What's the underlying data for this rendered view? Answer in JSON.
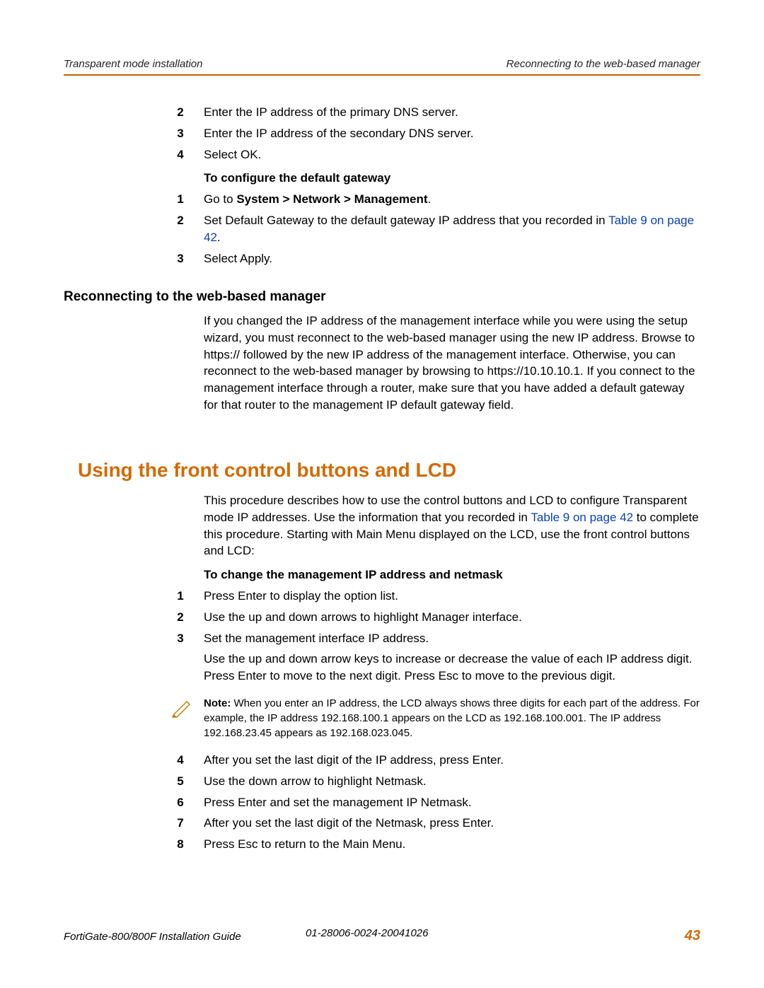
{
  "header": {
    "left": "Transparent mode installation",
    "right": "Reconnecting to the web-based manager"
  },
  "steps_a": {
    "s2": {
      "n": "2",
      "t": "Enter the IP address of the primary DNS server."
    },
    "s3": {
      "n": "3",
      "t": "Enter the IP address of the secondary DNS server."
    },
    "s4": {
      "n": "4",
      "t": "Select OK."
    }
  },
  "gateway": {
    "heading": "To configure the default gateway",
    "s1": {
      "n": "1",
      "pre": "Go to ",
      "bold": "System > Network > Management",
      "post": "."
    },
    "s2": {
      "n": "2",
      "pre": "Set Default Gateway to the default gateway IP address that you recorded in ",
      "link": "Table 9 on page 42",
      "post": "."
    },
    "s3": {
      "n": "3",
      "t": "Select Apply."
    }
  },
  "reconnect": {
    "heading": "Reconnecting to the web-based manager",
    "para": "If you changed the IP address of the management interface while you were using the setup wizard, you must reconnect to the web-based manager using the new IP address. Browse to https:// followed by the new IP address of the management interface. Otherwise, you can reconnect to the web-based manager by browsing to https://10.10.10.1. If you connect to the management interface through a router, make sure that you have added a default gateway for that router to the management IP default gateway field."
  },
  "lcd": {
    "heading": "Using the front control buttons and LCD",
    "intro_pre": "This procedure describes how to use the control buttons and LCD to configure Transparent mode IP addresses. Use the information that you recorded in ",
    "intro_link": "Table 9 on page 42",
    "intro_post": " to complete this procedure. Starting with Main Menu displayed on the LCD, use the front control buttons and LCD:",
    "sub": "To change the management IP address and netmask",
    "s1": {
      "n": "1",
      "t": "Press Enter to display the option list."
    },
    "s2": {
      "n": "2",
      "t": "Use the up and down arrows to highlight Manager interface."
    },
    "s3": {
      "n": "3",
      "t": "Set the management interface IP address.",
      "extra": "Use the up and down arrow keys to increase or decrease the value of each IP address digit. Press Enter to move to the next digit. Press Esc to move to the previous digit."
    },
    "note_label": "Note:",
    "note": " When you enter an IP address, the LCD always shows three digits for each part of the address. For example, the IP address 192.168.100.1 appears on the LCD as 192.168.100.001. The IP address 192.168.23.45 appears as 192.168.023.045.",
    "s4": {
      "n": "4",
      "t": "After you set the last digit of the IP address, press Enter."
    },
    "s5": {
      "n": "5",
      "t": "Use the down arrow to highlight Netmask."
    },
    "s6": {
      "n": "6",
      "t": "Press Enter and set the management IP Netmask."
    },
    "s7": {
      "n": "7",
      "t": "After you set the last digit of the Netmask, press Enter."
    },
    "s8": {
      "n": "8",
      "t": "Press Esc to return to the Main Menu."
    }
  },
  "footer": {
    "left": "FortiGate-800/800F Installation Guide",
    "center": "01-28006-0024-20041026",
    "page": "43"
  }
}
